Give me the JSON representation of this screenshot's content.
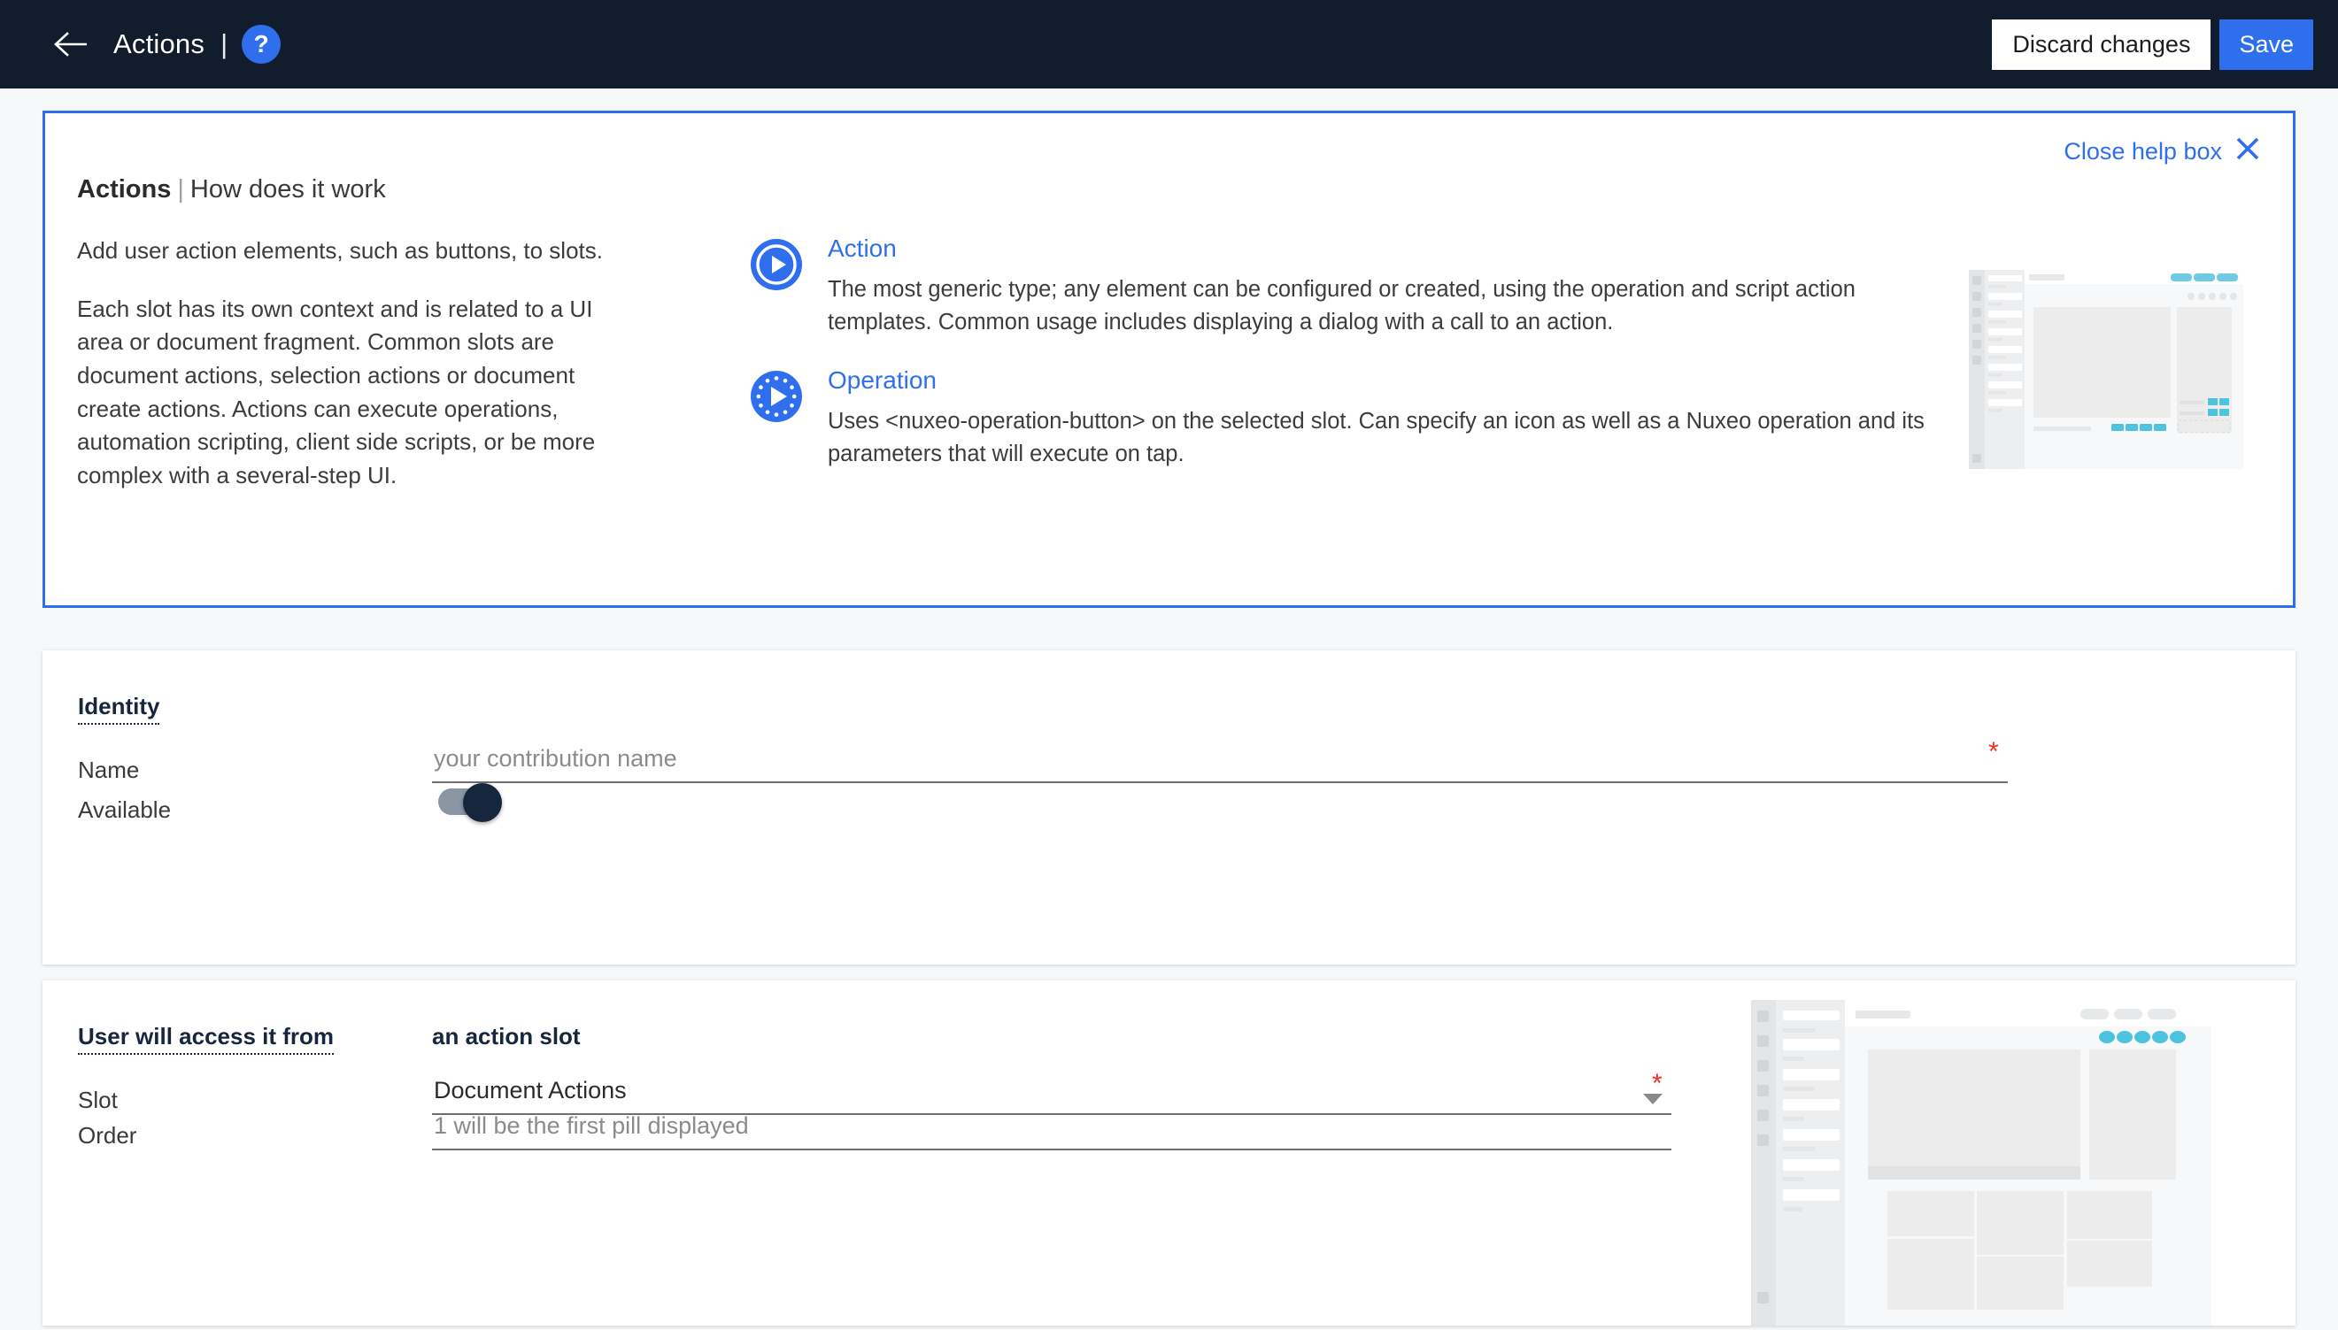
{
  "header": {
    "back_icon": "arrow-left-icon",
    "title": "Actions",
    "separator": "|",
    "help_badge": "?",
    "discard_label": "Discard changes",
    "save_label": "Save",
    "background": "#111d2d",
    "accent": "#2f6fed"
  },
  "help_box": {
    "close_label": "Close help box",
    "close_icon": "close-x-icon",
    "title_bold": "Actions",
    "title_sep": "|",
    "title_rest": "How does it work",
    "paragraphs": [
      "Add user action elements, such as buttons, to slots.",
      "Each slot has its own context and is related to a UI area or document fragment. Common slots are document actions, selection actions or document create actions. Actions can execute operations, automation scripting, client side scripts, or be more complex with a several-step UI."
    ],
    "items": [
      {
        "icon": "play-circle-icon",
        "title": "Action",
        "description": "The most generic type; any element can be configured or created, using the operation and script action templates. Common usage includes displaying a dialog with a call to an action."
      },
      {
        "icon": "play-dotted-circle-icon",
        "title": "Operation",
        "description": "Uses <nuxeo-operation-button> on the selected slot. Can specify an icon as well as a Nuxeo operation and its parameters that will execute on tap."
      }
    ],
    "border_color": "#2f6fed",
    "link_color": "#2f6fed"
  },
  "identity": {
    "section_title": "Identity",
    "name_label": "Name",
    "name_value": "",
    "name_placeholder": "your contribution name",
    "name_required": "*",
    "available_label": "Available",
    "available_on": true
  },
  "slot_section": {
    "section_title": "User will access it from",
    "subtitle": "an action slot",
    "slot_label": "Slot",
    "slot_value": "Document Actions",
    "slot_required": "*",
    "slot_caret": "chevron-down-icon",
    "order_label": "Order",
    "order_value": "",
    "order_placeholder": "1 will be the first pill displayed"
  },
  "colors": {
    "required": "#f0301c",
    "wireframe_accent": "#4ec3e0",
    "wireframe_grey": "#ececec",
    "page_bg": "#f7f8f9",
    "card_bg": "#ffffff"
  }
}
